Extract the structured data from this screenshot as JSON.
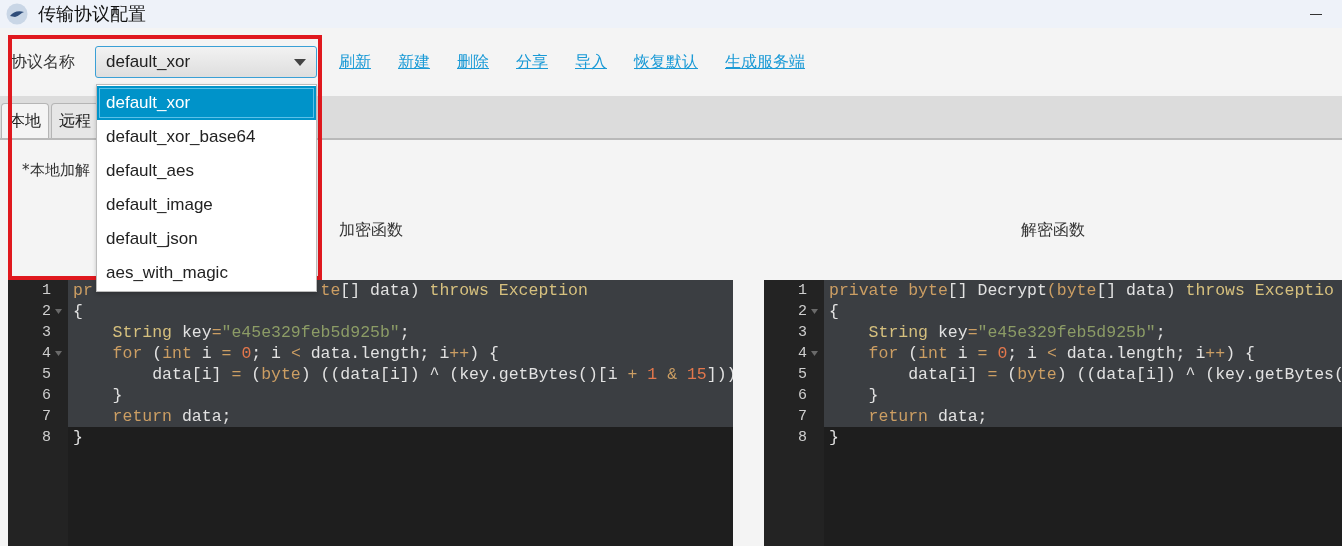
{
  "window": {
    "title": "传输协议配置"
  },
  "toolbar": {
    "label": "协议名称",
    "combo": {
      "value": "default_xor",
      "expanded": true,
      "options": [
        {
          "label": "default_xor",
          "selected": true
        },
        {
          "label": "default_xor_base64",
          "selected": false
        },
        {
          "label": "default_aes",
          "selected": false
        },
        {
          "label": "default_image",
          "selected": false
        },
        {
          "label": "default_json",
          "selected": false
        },
        {
          "label": "aes_with_magic",
          "selected": false
        }
      ]
    },
    "links": [
      "刷新",
      "新建",
      "删除",
      "分享",
      "导入",
      "恢复默认",
      "生成服务端"
    ]
  },
  "tabs": [
    {
      "label": "本地",
      "selected": true
    },
    {
      "label": "远程",
      "selected": false
    }
  ],
  "note": "*本地加解",
  "editors": [
    {
      "title": "加密函数",
      "lines": [
        {
          "n": "1",
          "fold": false,
          "selected": true,
          "tokens": [
            {
              "text": "pr",
              "kind": "kw"
            },
            {
              "kind": "gap"
            },
            {
              "text": "te",
              "kind": "kw"
            },
            {
              "text": "[] data) ",
              "kind": "plain"
            },
            {
              "text": "throws Exception",
              "kind": "type"
            }
          ]
        },
        {
          "n": "2",
          "fold": true,
          "selected": true,
          "tokens": [
            {
              "text": "{",
              "kind": "plain"
            }
          ]
        },
        {
          "n": "3",
          "fold": false,
          "selected": true,
          "tokens": [
            {
              "text": "    String",
              "kind": "type"
            },
            {
              "text": " key",
              "kind": "plain"
            },
            {
              "text": "=",
              "kind": "op"
            },
            {
              "text": "\"e45e329feb5d925b\"",
              "kind": "str"
            },
            {
              "text": ";",
              "kind": "plain"
            }
          ]
        },
        {
          "n": "4",
          "fold": true,
          "selected": true,
          "tokens": [
            {
              "text": "    for",
              "kind": "kw"
            },
            {
              "text": " (",
              "kind": "plain"
            },
            {
              "text": "int",
              "kind": "kw"
            },
            {
              "text": " i ",
              "kind": "plain"
            },
            {
              "text": "= ",
              "kind": "op"
            },
            {
              "text": "0",
              "kind": "num"
            },
            {
              "text": "; i ",
              "kind": "plain"
            },
            {
              "text": "<",
              "kind": "op"
            },
            {
              "text": " data.length; i",
              "kind": "plain"
            },
            {
              "text": "++",
              "kind": "op"
            },
            {
              "text": ") {",
              "kind": "plain"
            }
          ]
        },
        {
          "n": "5",
          "fold": false,
          "selected": true,
          "tokens": [
            {
              "text": "        data[i] ",
              "kind": "plain"
            },
            {
              "text": "=",
              "kind": "op"
            },
            {
              "text": " (",
              "kind": "plain"
            },
            {
              "text": "byte",
              "kind": "kw"
            },
            {
              "text": ") ((data[i]) ^ (key.getBytes()[i ",
              "kind": "plain"
            },
            {
              "text": "+ ",
              "kind": "op"
            },
            {
              "text": "1 ",
              "kind": "num"
            },
            {
              "text": "& ",
              "kind": "op"
            },
            {
              "text": "15",
              "kind": "num"
            },
            {
              "text": "]))",
              "kind": "plain"
            }
          ]
        },
        {
          "n": "6",
          "fold": false,
          "selected": true,
          "tokens": [
            {
              "text": "    }",
              "kind": "plain"
            }
          ]
        },
        {
          "n": "7",
          "fold": false,
          "selected": true,
          "tokens": [
            {
              "text": "    return",
              "kind": "kw"
            },
            {
              "text": " data;",
              "kind": "plain"
            }
          ]
        },
        {
          "n": "8",
          "fold": false,
          "selected": false,
          "tokens": [
            {
              "text": "}",
              "kind": "plain"
            }
          ]
        }
      ]
    },
    {
      "title": "解密函数",
      "lines": [
        {
          "n": "1",
          "fold": false,
          "selected": true,
          "tokens": [
            {
              "text": "private byte",
              "kind": "kw"
            },
            {
              "text": "[] Decrypt",
              "kind": "plain"
            },
            {
              "text": "(",
              "kind": "op"
            },
            {
              "text": "byte",
              "kind": "kw"
            },
            {
              "text": "[] data) ",
              "kind": "plain"
            },
            {
              "text": "throws Exceptio",
              "kind": "type"
            }
          ]
        },
        {
          "n": "2",
          "fold": true,
          "selected": true,
          "tokens": [
            {
              "text": "{",
              "kind": "plain"
            }
          ]
        },
        {
          "n": "3",
          "fold": false,
          "selected": true,
          "tokens": [
            {
              "text": "    String",
              "kind": "type"
            },
            {
              "text": " key",
              "kind": "plain"
            },
            {
              "text": "=",
              "kind": "op"
            },
            {
              "text": "\"e45e329feb5d925b\"",
              "kind": "str"
            },
            {
              "text": ";",
              "kind": "plain"
            }
          ]
        },
        {
          "n": "4",
          "fold": true,
          "selected": true,
          "tokens": [
            {
              "text": "    for",
              "kind": "kw"
            },
            {
              "text": " (",
              "kind": "plain"
            },
            {
              "text": "int",
              "kind": "kw"
            },
            {
              "text": " i ",
              "kind": "plain"
            },
            {
              "text": "= ",
              "kind": "op"
            },
            {
              "text": "0",
              "kind": "num"
            },
            {
              "text": "; i ",
              "kind": "plain"
            },
            {
              "text": "<",
              "kind": "op"
            },
            {
              "text": " data.length; i",
              "kind": "plain"
            },
            {
              "text": "++",
              "kind": "op"
            },
            {
              "text": ") {",
              "kind": "plain"
            }
          ]
        },
        {
          "n": "5",
          "fold": false,
          "selected": true,
          "tokens": [
            {
              "text": "        data[i] ",
              "kind": "plain"
            },
            {
              "text": "=",
              "kind": "op"
            },
            {
              "text": " (",
              "kind": "plain"
            },
            {
              "text": "byte",
              "kind": "kw"
            },
            {
              "text": ") ((data[i]) ^ (key.getBytes(",
              "kind": "plain"
            }
          ]
        },
        {
          "n": "6",
          "fold": false,
          "selected": true,
          "tokens": [
            {
              "text": "    }",
              "kind": "plain"
            }
          ]
        },
        {
          "n": "7",
          "fold": false,
          "selected": true,
          "tokens": [
            {
              "text": "    return",
              "kind": "kw"
            },
            {
              "text": " data;",
              "kind": "plain"
            }
          ]
        },
        {
          "n": "8",
          "fold": false,
          "selected": false,
          "tokens": [
            {
              "text": "}",
              "kind": "plain"
            }
          ]
        }
      ]
    }
  ]
}
